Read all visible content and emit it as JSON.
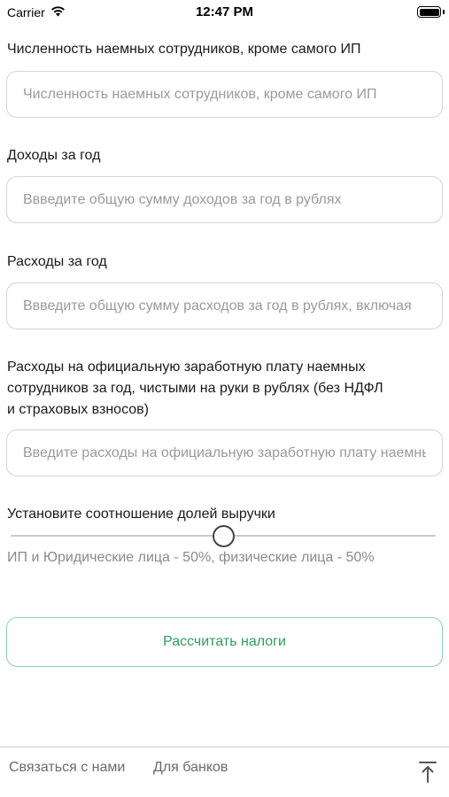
{
  "status_bar": {
    "carrier": "Carrier",
    "time": "12:47 PM",
    "wifi_icon": "wifi-icon",
    "battery_icon": "battery-icon"
  },
  "fields": [
    {
      "label": "Численность наемных сотрудников, кроме самого ИП",
      "placeholder": "Численность наемных сотрудников, кроме самого ИП"
    },
    {
      "label": "Доходы за год",
      "placeholder": "Ввведите общую сумму доходов за год в рублях"
    },
    {
      "label": "Расходы за год",
      "placeholder": "Ввведите общую сумму расходов за год в рублях, включая"
    },
    {
      "label_lines": [
        "Расходы на официальную заработную плату наемных",
        "сотрудников за год, чистыми на руки в рублях (без НДФЛ",
        "и страховых взносов)"
      ],
      "placeholder": "Введите расходы на официальную заработную плату наемных"
    }
  ],
  "ratio": {
    "label": "Установите соотношение долей выручки",
    "value_percent": 50,
    "caption": "ИП и Юридические лица - 50%, физические лица - 50%"
  },
  "calc_button_label": "Рассчитать налоги",
  "footer": {
    "contact_label": "Связаться с нами",
    "banks_label": "Для банков",
    "scroll_top_icon": "arrow-up-to-line-icon"
  },
  "colors": {
    "accent_green": "#2f9d5f",
    "button_border": "#8fd2a8",
    "placeholder": "#9a9a9a"
  }
}
